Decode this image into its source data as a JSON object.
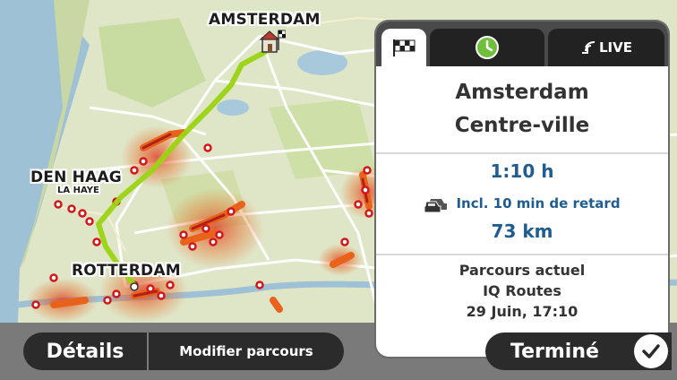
{
  "map": {
    "cities": [
      {
        "name": "AMSTERDAM"
      },
      {
        "name": "DEN HAAG"
      },
      {
        "name": "LA HAYE"
      },
      {
        "name": "ROTTERDAM"
      }
    ]
  },
  "summary": {
    "tabs": [
      {
        "name": "destination-tab",
        "icon": "checkered-flag-icon"
      },
      {
        "name": "time-tab",
        "icon": "clock-icon"
      },
      {
        "name": "live-tab",
        "icon": "signal-icon",
        "label": "LIVE"
      }
    ],
    "destination_line1": "Amsterdam",
    "destination_line2": "Centre-ville",
    "duration": "1:10 h",
    "delay": "Incl. 10 min de retard",
    "distance": "73 km",
    "route_type": "Parcours actuel",
    "routing": "IQ Routes",
    "datetime": "29 Juin, 17:10"
  },
  "buttons": {
    "details": "Détails",
    "modify": "Modifier parcours",
    "done": "Terminé"
  },
  "colors": {
    "route": "#9ad411",
    "traffic": "#e8621b",
    "delay_text": "#1f5d91",
    "button_bg": "#2b2b2b"
  }
}
